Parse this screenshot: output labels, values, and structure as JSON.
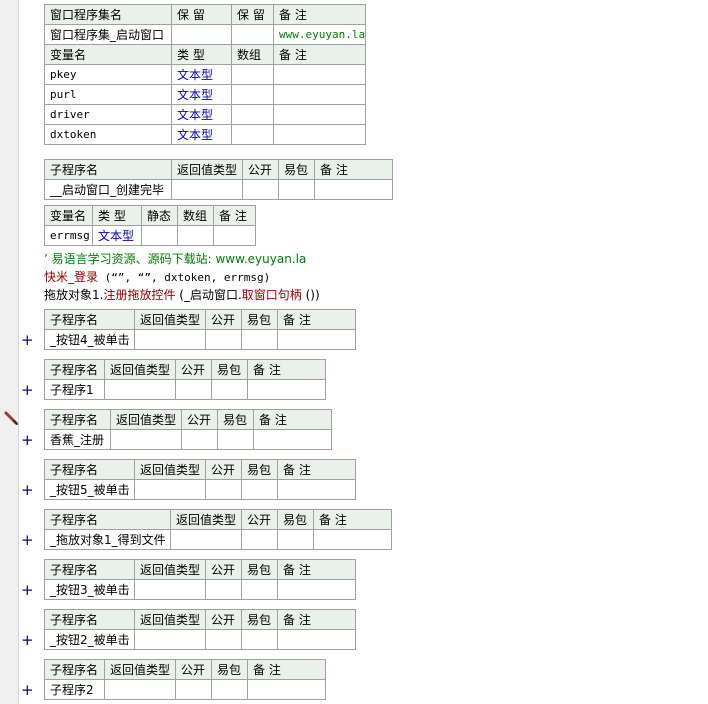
{
  "window_header": {
    "col1": "窗口程序集名",
    "col2": "保 留",
    "col3": "保 留",
    "col4": "备 注",
    "name": "窗口程序集_启动窗口",
    "note": "www.eyuyan.la"
  },
  "vars_header": {
    "col1": "变量名",
    "col2": "类 型",
    "col3": "数组",
    "col4": "备 注"
  },
  "vars": [
    {
      "name": "pkey",
      "type": "文本型"
    },
    {
      "name": "purl",
      "type": "文本型"
    },
    {
      "name": "driver",
      "type": "文本型"
    },
    {
      "name": "dxtoken",
      "type": "文本型"
    }
  ],
  "sub_header": {
    "name": "子程序名",
    "ret": "返回值类型",
    "pub": "公开",
    "easy": "易包",
    "note": "备 注"
  },
  "main_sub": {
    "name": "__启动窗口_创建完毕"
  },
  "local_header": {
    "name": "变量名",
    "type": "类 型",
    "static": "静态",
    "arr": "数组",
    "note": "备 注"
  },
  "local_var": {
    "name": "errmsg",
    "type": "文本型"
  },
  "code": {
    "comment": "’ 易语言学习资源、源码下载站: www.eyuyan.la",
    "line2_func": "快米_登录",
    "line2_args": " (“”, “”, dxtoken, errmsg)",
    "line3_obj": "拖放对象1.",
    "line3_method": "注册拖放控件",
    "line3_open": " (_启动窗口.",
    "line3_inner": "取窗口句柄",
    "line3_close": " ())"
  },
  "subs": [
    {
      "name": "_按钮4_被单击"
    },
    {
      "name": "子程序1"
    },
    {
      "name": "香蕉_注册"
    },
    {
      "name": "_按钮5_被单击"
    },
    {
      "name": "_拖放对象1_得到文件"
    },
    {
      "name": "_按钮3_被单击"
    },
    {
      "name": "_按钮2_被单击"
    },
    {
      "name": "子程序2"
    }
  ],
  "expand_symbol": "+"
}
